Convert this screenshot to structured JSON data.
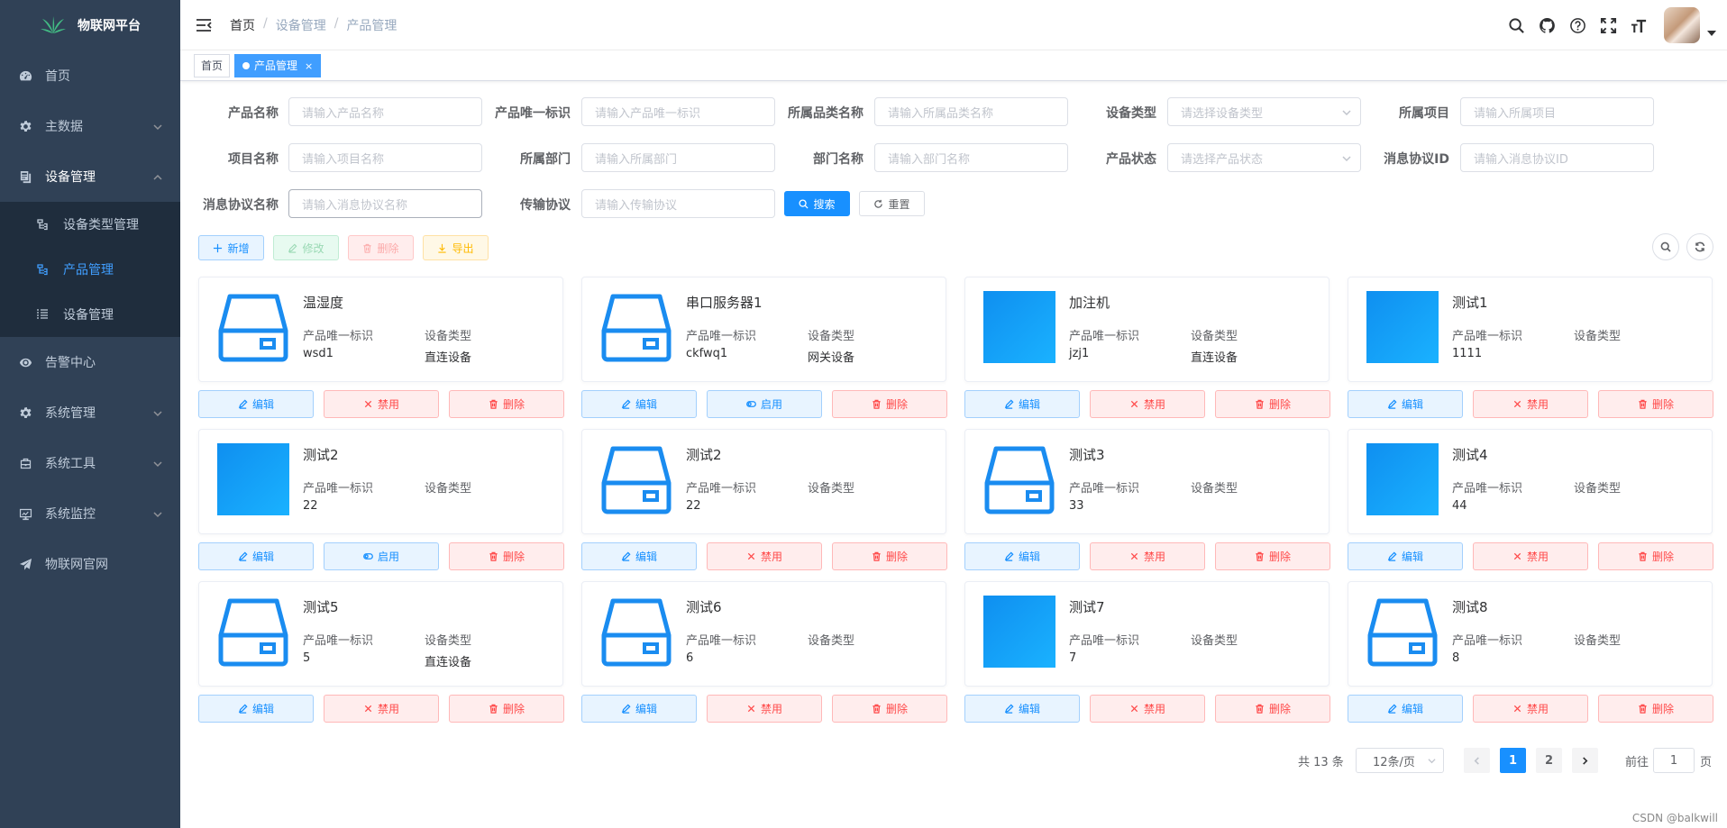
{
  "app": {
    "title": "物联网平台"
  },
  "sidebar": {
    "items": [
      {
        "label": "首页",
        "icon": "dashboard-icon"
      },
      {
        "label": "主数据",
        "icon": "gear-icon"
      },
      {
        "label": "设备管理",
        "icon": "device-icon"
      },
      {
        "label": "告警中心",
        "icon": "eye-icon"
      },
      {
        "label": "系统管理",
        "icon": "gear-icon"
      },
      {
        "label": "系统工具",
        "icon": "tool-icon"
      },
      {
        "label": "系统监控",
        "icon": "monitor-icon"
      },
      {
        "label": "物联网官网",
        "icon": "send-icon"
      }
    ],
    "submenu": [
      {
        "label": "设备类型管理",
        "icon": "tree-icon"
      },
      {
        "label": "产品管理",
        "icon": "tree-icon"
      },
      {
        "label": "设备管理",
        "icon": "list-icon"
      }
    ]
  },
  "breadcrumb": {
    "home": "首页",
    "sep": "/",
    "level1": "设备管理",
    "level2": "产品管理"
  },
  "tags": {
    "home": "首页",
    "active": "产品管理",
    "close": "×"
  },
  "filters": [
    {
      "label": "产品名称",
      "placeholder": "请输入产品名称"
    },
    {
      "label": "产品唯一标识",
      "placeholder": "请输入产品唯一标识"
    },
    {
      "label": "所属品类名称",
      "placeholder": "请输入所属品类名称"
    },
    {
      "label": "设备类型",
      "placeholder": "请选择设备类型"
    },
    {
      "label": "所属项目",
      "placeholder": "请输入所属项目"
    },
    {
      "label": "项目名称",
      "placeholder": "请输入项目名称"
    },
    {
      "label": "所属部门",
      "placeholder": "请输入所属部门"
    },
    {
      "label": "部门名称",
      "placeholder": "请输入部门名称"
    },
    {
      "label": "产品状态",
      "placeholder": "请选择产品状态"
    },
    {
      "label": "消息协议ID",
      "placeholder": "请输入消息协议ID"
    },
    {
      "label": "消息协议名称",
      "placeholder": "请输入消息协议名称"
    },
    {
      "label": "传输协议",
      "placeholder": "请输入传输协议"
    }
  ],
  "buttons": {
    "search": "搜索",
    "reset": "重置",
    "add": "新增",
    "edit": "修改",
    "delete": "删除",
    "export": "导出"
  },
  "card_labels": {
    "id": "产品唯一标识",
    "type": "设备类型"
  },
  "card_actions": {
    "edit": "编辑",
    "disable": "禁用",
    "enable": "启用",
    "delete": "删除"
  },
  "products": [
    {
      "name": "温湿度",
      "id": "wsd1",
      "type": "直连设备",
      "image": "drive-icon",
      "status_action": "disable"
    },
    {
      "name": "串口服务器1",
      "id": "ckfwq1",
      "type": "网关设备",
      "image": "drive-icon",
      "status_action": "enable"
    },
    {
      "name": "加注机",
      "id": "jzj1",
      "type": "直连设备",
      "image": "blue-image",
      "status_action": "disable"
    },
    {
      "name": "测试1",
      "id": "1111",
      "type": "",
      "image": "blue-image",
      "status_action": "disable"
    },
    {
      "name": "测试2",
      "id": "22",
      "type": "",
      "image": "blue-image",
      "status_action": "enable"
    },
    {
      "name": "测试2",
      "id": "22",
      "type": "",
      "image": "drive-icon",
      "status_action": "disable"
    },
    {
      "name": "测试3",
      "id": "33",
      "type": "",
      "image": "drive-icon",
      "status_action": "disable"
    },
    {
      "name": "测试4",
      "id": "44",
      "type": "",
      "image": "blue-image",
      "status_action": "disable"
    },
    {
      "name": "测试5",
      "id": "5",
      "type": "直连设备",
      "image": "drive-icon",
      "status_action": "disable"
    },
    {
      "name": "测试6",
      "id": "6",
      "type": "",
      "image": "drive-icon",
      "status_action": "disable"
    },
    {
      "name": "测试7",
      "id": "7",
      "type": "",
      "image": "blue-image",
      "status_action": "disable"
    },
    {
      "name": "测试8",
      "id": "8",
      "type": "",
      "image": "drive-icon",
      "status_action": "disable"
    }
  ],
  "pagination": {
    "total": "共 13 条",
    "page_size": "12条/页",
    "pages": [
      "1",
      "2"
    ],
    "current": "1",
    "goto_label": "前往",
    "goto_value": "1",
    "page_unit": "页"
  },
  "watermark": "CSDN @balkwill",
  "colors": {
    "sidebar_bg": "#304156",
    "submenu_bg": "#1f2d3d",
    "primary": "#1890ff",
    "danger": "#ff4949"
  }
}
